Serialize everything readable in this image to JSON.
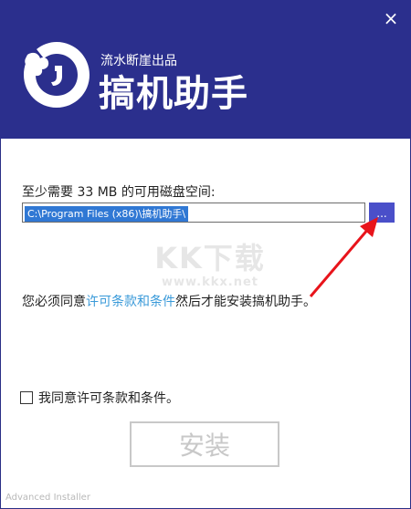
{
  "header": {
    "publisher": "流水断崖出品",
    "title": "搞机助手",
    "close_glyph": "×",
    "bg_color": "#2b2f8d"
  },
  "install": {
    "space_label": "至少需要 33 MB 的可用磁盘空间:",
    "path_value": "C:\\Program Files (x86)\\搞机助手\\",
    "browse_label": "...",
    "agree_prefix": "您必须同意",
    "license_link": "许可条款和条件",
    "agree_suffix": "然后才能安装搞机助手。",
    "checkbox_label": "我同意许可条款和条件。",
    "install_button": "安装"
  },
  "watermark": {
    "main": "KK下载",
    "url": "www.kkx.net"
  },
  "footer": {
    "text": "Advanced Installer"
  },
  "icons": {
    "logo": "puzzle-logo-icon",
    "close": "close-icon",
    "arrow": "red-arrow-annotation"
  }
}
